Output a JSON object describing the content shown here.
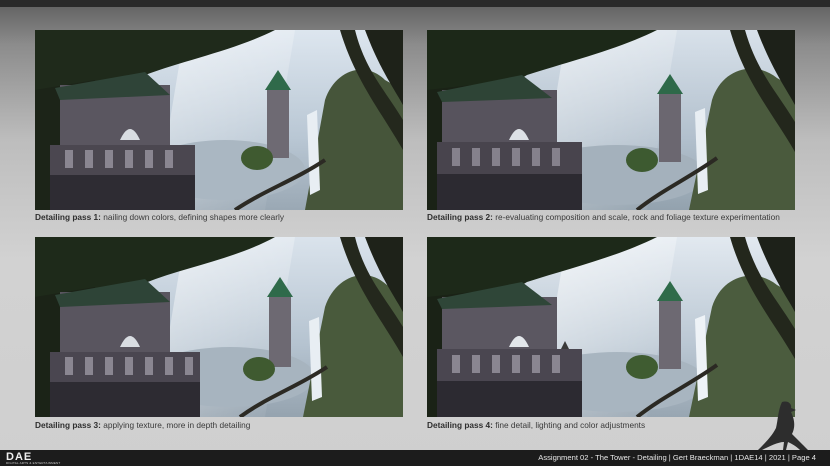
{
  "panels": [
    {
      "bold": "Detailing pass 1:",
      "text": " nailing down colors, defining shapes more clearly"
    },
    {
      "bold": "Detailing pass 2:",
      "text": " re-evaluating composition and scale, rock and foliage texture experimentation"
    },
    {
      "bold": "Detailing pass 3:",
      "text": " applying texture, more in depth detailing"
    },
    {
      "bold": "Detailing pass 4:",
      "text": " fine detail, lighting and color adjustments"
    }
  ],
  "footer": {
    "logo": "DAE",
    "logo_sub": "DIGITAL ARTS & ENTERTAINMENT",
    "text": "Assignment  02 - The Tower - Detailing | Gert Braeckman | 1DAE14 | 2021 | Page 4"
  },
  "colors": {
    "background": "#cfcfcf",
    "footer_bar": "#1c1c1c",
    "foliage": "#2f4a24",
    "sky": "#c9d6e3"
  }
}
